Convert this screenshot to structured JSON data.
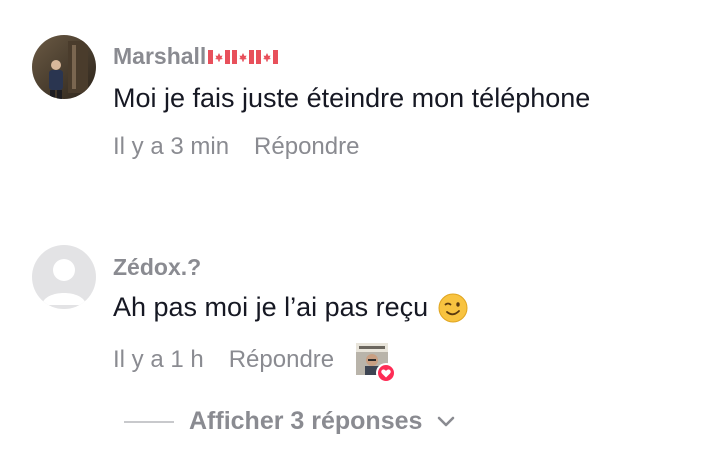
{
  "comments": [
    {
      "username": "Marshall",
      "flags": [
        "canada-flag",
        "canada-flag",
        "canada-flag"
      ],
      "text": "Moi je fais juste éteindre mon téléphone",
      "time": "Il y a 3 min",
      "reply_label": "Répondre",
      "avatar_icon": "user-photo-avatar"
    },
    {
      "username": "Zédox.?",
      "text": "Ah pas moi je l’ai pas reçu",
      "emoji": "winking-face-emoji",
      "time": "Il y a 1 h",
      "reply_label": "Répondre",
      "avatar_icon": "default-avatar",
      "liked_by_creator": true
    }
  ],
  "show_replies": {
    "label": "Afficher 3 réponses",
    "icon": "chevron-down-icon"
  },
  "colors": {
    "text_primary": "#161823",
    "text_secondary": "#8a8b91",
    "heart": "#fe2c55",
    "flag_red": "#e8505b"
  }
}
